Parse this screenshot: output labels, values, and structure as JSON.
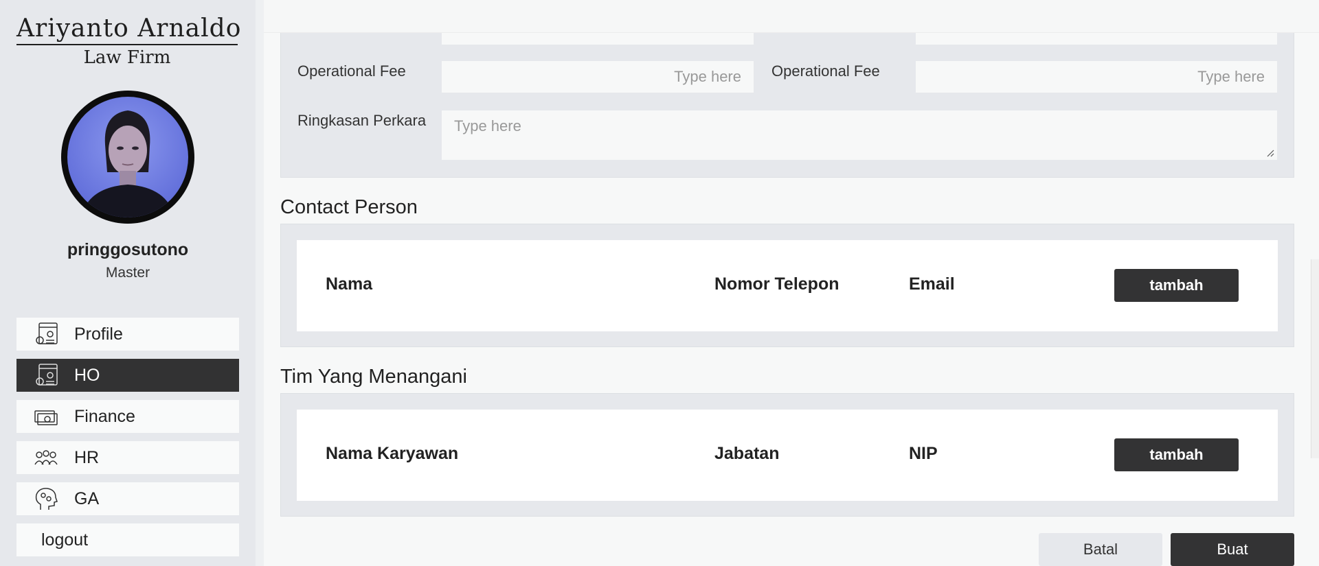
{
  "sidebar": {
    "logo": {
      "line1": "Ariyanto Arnaldo",
      "line2": "Law Firm"
    },
    "user": {
      "name": "pringgosutono",
      "role": "Master"
    },
    "menu": [
      {
        "label": "Profile",
        "icon": "profile-settings-icon"
      },
      {
        "label": "HO",
        "icon": "ho-settings-icon",
        "active": true
      },
      {
        "label": "Finance",
        "icon": "money-icon"
      },
      {
        "label": "HR",
        "icon": "team-icon"
      },
      {
        "label": "GA",
        "icon": "head-gears-icon"
      },
      {
        "label": "logout"
      }
    ]
  },
  "form": {
    "left_fee_label": "Operational Fee",
    "left_fee_placeholder": "Type here",
    "right_fee_label": "Operational Fee",
    "right_fee_placeholder": "Type here",
    "summary_label": "Ringkasan Perkara",
    "summary_placeholder": "Type here"
  },
  "contact": {
    "title": "Contact Person",
    "columns": [
      "Nama",
      "Nomor Telepon",
      "Email"
    ],
    "add_label": "tambah"
  },
  "team": {
    "title": "Tim Yang Menangani",
    "columns": [
      "Nama Karyawan",
      "Jabatan",
      "NIP"
    ],
    "add_label": "tambah"
  },
  "actions": {
    "cancel": "Batal",
    "create": "Buat"
  },
  "colors": {
    "dark": "#333334",
    "panel": "#e6e8ec",
    "input": "#f7f8f8"
  }
}
